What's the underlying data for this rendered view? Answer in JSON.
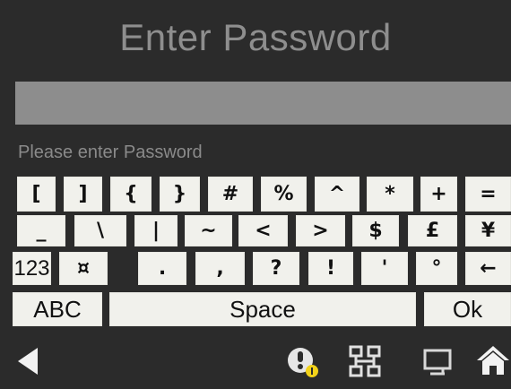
{
  "title": "Enter Password",
  "password_field": {
    "value": ""
  },
  "hint": "Please enter Password",
  "keyboard": {
    "row1": [
      "[",
      "]",
      "{",
      "}",
      "#",
      "%",
      "^",
      "*",
      "+",
      "="
    ],
    "row2": [
      "_",
      "\\",
      "|",
      "~",
      "<",
      ">",
      "$",
      "£",
      "¥"
    ],
    "row3": [
      "123",
      "¤",
      ".",
      ",",
      "?",
      "!",
      "'",
      "°",
      "←"
    ],
    "row4": [
      "ABC",
      "Space",
      "Ok"
    ]
  },
  "nav": {
    "icons": [
      "back-arrow-icon",
      "notification-icon",
      "network-icon",
      "display-icon",
      "home-icon"
    ],
    "badge_color": "#f2d21a"
  }
}
